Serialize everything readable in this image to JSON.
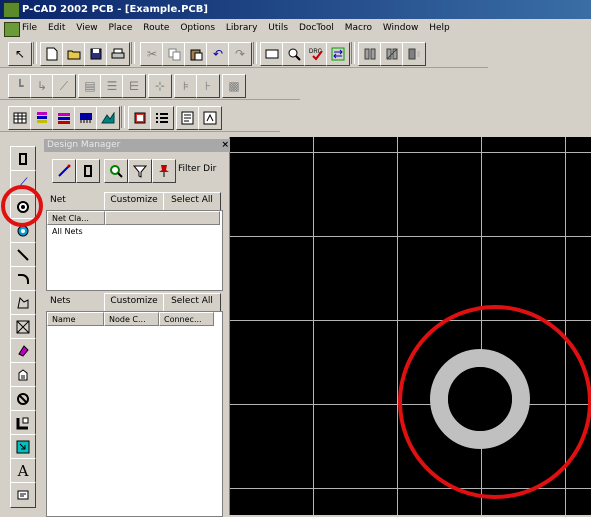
{
  "window": {
    "title": "P-CAD 2002 PCB - [Example.PCB]"
  },
  "menu": [
    "File",
    "Edit",
    "View",
    "Place",
    "Route",
    "Options",
    "Library",
    "Utils",
    "DocTool",
    "Macro",
    "Window",
    "Help"
  ],
  "design_manager": {
    "title": "Design Manager",
    "close_glyph": "×",
    "filter_label": "Filter Dir",
    "net_panel": {
      "header": "Net",
      "customize_label": "Customize",
      "select_all_label": "Select All",
      "column": "Net Cla...",
      "rows": [
        "All Nets"
      ]
    },
    "nets_panel": {
      "header": "Nets",
      "customize_label": "Customize",
      "select_all_label": "Select All",
      "columns": [
        "Name",
        "Node C...",
        "Connec..."
      ]
    }
  },
  "colors": {
    "title_bar": "#0a246a",
    "canvas_bg": "#000000",
    "grid": "#b4b4b4",
    "pad": "#c0c0c0",
    "highlight_circle": "#e01010"
  }
}
